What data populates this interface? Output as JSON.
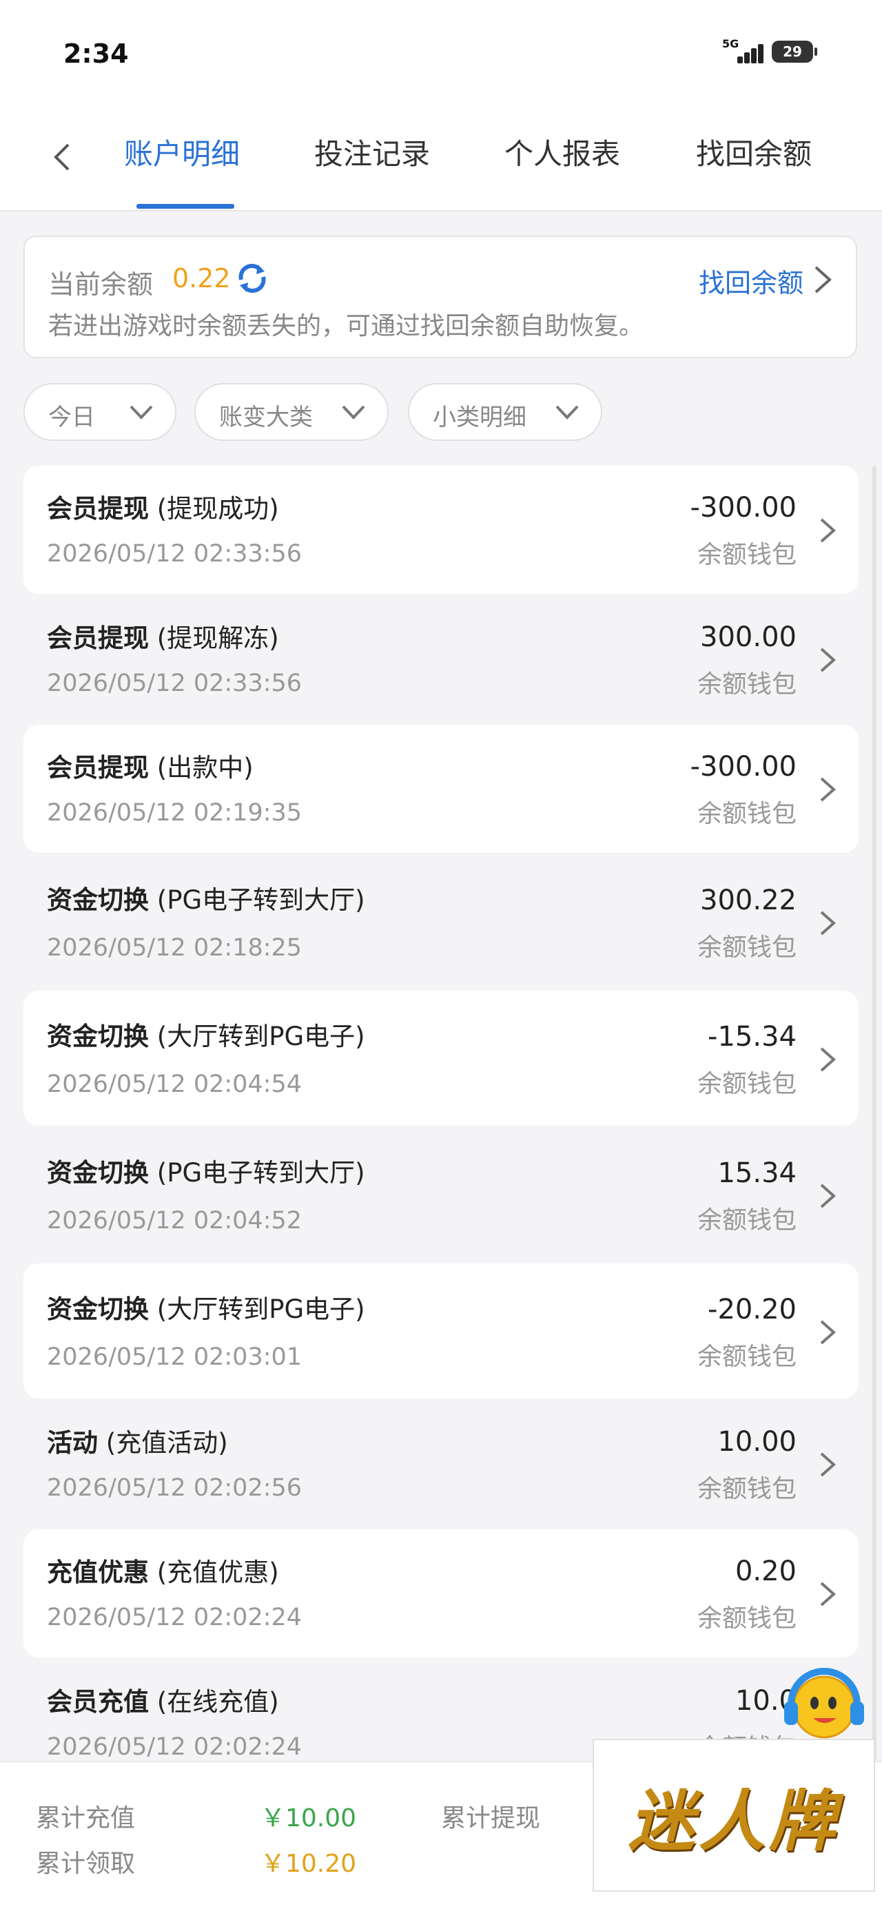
{
  "status_bar": {
    "time": "2:34",
    "network": "5G",
    "battery": "29"
  },
  "nav": {
    "tabs": [
      {
        "label": "账户明细",
        "active": true
      },
      {
        "label": "投注记录",
        "active": false
      },
      {
        "label": "个人报表",
        "active": false
      },
      {
        "label": "找回余额",
        "active": false
      }
    ]
  },
  "balance": {
    "label": "当前余额",
    "value": "0.22",
    "recover_link": "找回余额",
    "hint": "若进出游戏时余额丢失的，可通过找回余额自助恢复。"
  },
  "filters": [
    {
      "label": "今日"
    },
    {
      "label": "账变大类"
    },
    {
      "label": "小类明细"
    }
  ],
  "transactions": [
    {
      "type": "会员提现",
      "detail": "(提现成功)",
      "date": "2026/05/12 02:33:56",
      "amount": "-300.00",
      "wallet": "余额钱包"
    },
    {
      "type": "会员提现",
      "detail": "(提现解冻)",
      "date": "2026/05/12 02:33:56",
      "amount": "300.00",
      "wallet": "余额钱包"
    },
    {
      "type": "会员提现",
      "detail": "(出款中)",
      "date": "2026/05/12 02:19:35",
      "amount": "-300.00",
      "wallet": "余额钱包"
    },
    {
      "type": "资金切换",
      "detail": "(PG电子转到大厅)",
      "date": "2026/05/12 02:18:25",
      "amount": "300.22",
      "wallet": "余额钱包"
    },
    {
      "type": "资金切换",
      "detail": "(大厅转到PG电子)",
      "date": "2026/05/12 02:04:54",
      "amount": "-15.34",
      "wallet": "余额钱包"
    },
    {
      "type": "资金切换",
      "detail": "(PG电子转到大厅)",
      "date": "2026/05/12 02:04:52",
      "amount": "15.34",
      "wallet": "余额钱包"
    },
    {
      "type": "资金切换",
      "detail": "(大厅转到PG电子)",
      "date": "2026/05/12 02:03:01",
      "amount": "-20.20",
      "wallet": "余额钱包"
    },
    {
      "type": "活动",
      "detail": "(充值活动)",
      "date": "2026/05/12 02:02:56",
      "amount": "10.00",
      "wallet": "余额钱包"
    },
    {
      "type": "充值优惠",
      "detail": "(充值优惠)",
      "date": "2026/05/12 02:02:24",
      "amount": "0.20",
      "wallet": "余额钱包"
    },
    {
      "type": "会员充值",
      "detail": "(在线充值)",
      "date": "2026/05/12 02:02:24",
      "amount": "10.0",
      "wallet": "余额钱包"
    }
  ],
  "footer": {
    "total_recharge_label": "累计充值",
    "total_recharge_value": "￥10.00",
    "total_received_label": "累计领取",
    "total_received_value": "￥10.20",
    "total_withdraw_label": "累计提现"
  },
  "brand": {
    "text": "迷人牌"
  },
  "colors": {
    "accent": "#2a72d6",
    "balance": "#f0a11e",
    "green": "#3aa54a",
    "gold": "#e0a21a"
  }
}
